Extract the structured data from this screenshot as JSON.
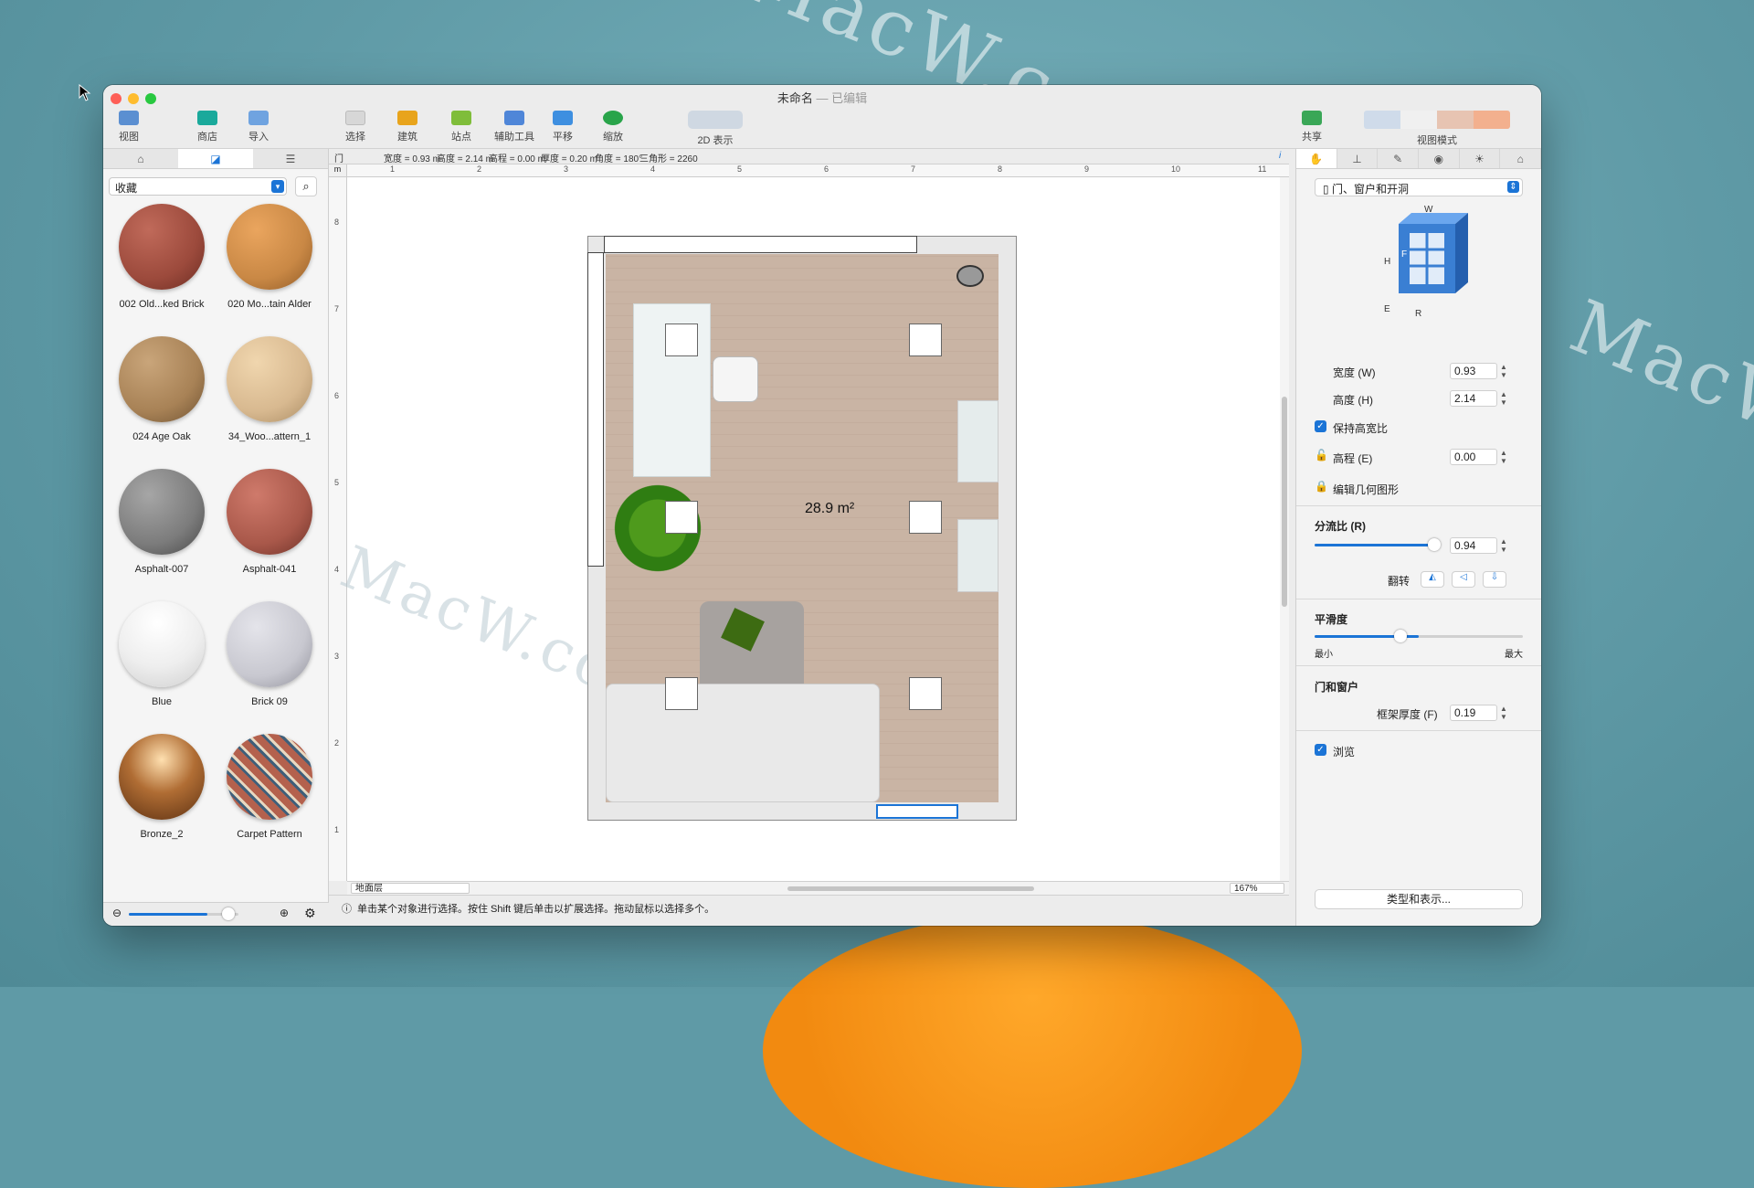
{
  "window": {
    "title": "未命名",
    "edited": "— 已编辑"
  },
  "toolbar": [
    {
      "label": "视图"
    },
    {
      "label": "商店"
    },
    {
      "label": "导入"
    },
    {
      "label": "选择"
    },
    {
      "label": "建筑"
    },
    {
      "label": "站点"
    },
    {
      "label": "辅助工具"
    },
    {
      "label": "平移"
    },
    {
      "label": "缩放"
    },
    {
      "label": "2D 表示"
    },
    {
      "label": "共享"
    },
    {
      "label": "视图模式"
    }
  ],
  "left": {
    "collection": "收藏",
    "materials": [
      {
        "name": "002 Old...ked Brick",
        "color": "#9c4a3c"
      },
      {
        "name": "020 Mo...tain Alder",
        "color": "#c98845"
      },
      {
        "name": "024 Age Oak",
        "color": "#a88256"
      },
      {
        "name": "34_Woo...attern_1",
        "color": "#d8b990"
      },
      {
        "name": "Asphalt-007",
        "color": "#7c7c7c"
      },
      {
        "name": "Asphalt-041",
        "color": "#a9584a"
      },
      {
        "name": "Blue",
        "color": "#eeeeee"
      },
      {
        "name": "Brick 09",
        "color": "#c8c8d0"
      },
      {
        "name": "Bronze_2",
        "color": "#b06d34"
      },
      {
        "name": "Carpet Pattern",
        "color": "#b4614d"
      }
    ]
  },
  "infobar": {
    "type": "门",
    "width": "宽度 = 0.93 m",
    "height": "高度 = 2.14 m",
    "elevation": "高程 = 0.00 m",
    "thickness": "厚度 = 0.20 m",
    "angle": "角度 = 180°",
    "triangles": "三角形 = 2260",
    "info": "i"
  },
  "rulers": {
    "corner": "m",
    "h": [
      "1",
      "2",
      "3",
      "4",
      "5",
      "6",
      "7",
      "8",
      "9",
      "10",
      "11"
    ],
    "v": [
      "8",
      "7",
      "6",
      "5",
      "4",
      "3",
      "2",
      "1"
    ]
  },
  "plan": {
    "area": "28.9 m²"
  },
  "floorbar": {
    "level": "地面层",
    "zoom": "167%"
  },
  "status": "单击某个对象进行选择。按住 Shift 键后单击以扩展选择。拖动鼠标以选择多个。",
  "right": {
    "category": "门、窗户和开洞",
    "diagram": {
      "w": "W",
      "h": "H",
      "f": "F",
      "e": "E",
      "r": "R"
    },
    "width_label": "宽度 (W)",
    "width_value": "0.93",
    "height_label": "高度 (H)",
    "height_value": "2.14",
    "keep_ratio": "保持高宽比",
    "elev_label": "高程 (E)",
    "elev_value": "0.00",
    "edit_geometry": "编辑几何图形",
    "split_title": "分流比 (R)",
    "split_value": "0.94",
    "split_level": 0.94,
    "flip": "翻转",
    "smooth_title": "平滑度",
    "smooth_min": "最小",
    "smooth_max": "最大",
    "smooth_level": 0.5,
    "doorwin_title": "门和窗户",
    "frame_label": "框架厚度 (F)",
    "frame_value": "0.19",
    "browse": "浏览",
    "type_button": "类型和表示..."
  },
  "colors": {
    "accent": "#1b74d6",
    "close": "#fe5f57",
    "min": "#febc2e",
    "max": "#28c840"
  }
}
